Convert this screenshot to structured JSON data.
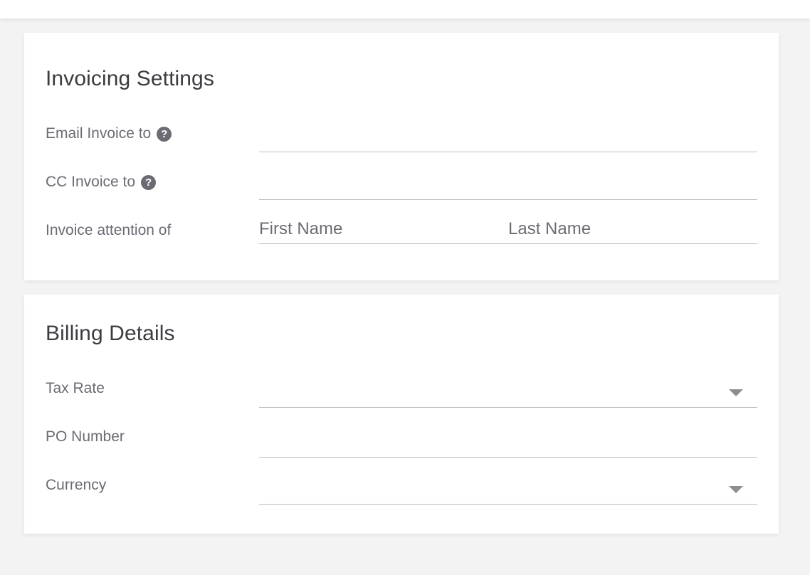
{
  "invoicing": {
    "title": "Invoicing Settings",
    "email_label": "Email Invoice to",
    "email_value": "",
    "cc_label": "CC Invoice to",
    "cc_value": "",
    "attention_label": "Invoice attention of",
    "first_name_placeholder": "First Name",
    "last_name_placeholder": "Last Name"
  },
  "billing": {
    "title": "Billing Details",
    "tax_rate_label": "Tax Rate",
    "tax_rate_value": "",
    "po_number_label": "PO Number",
    "po_number_value": "",
    "currency_label": "Currency",
    "currency_value": ""
  },
  "icons": {
    "help": "question-circle-icon",
    "dropdown": "caret-down-icon"
  },
  "help_glyph": "?",
  "colors": {
    "background": "#f3f3f3",
    "card": "#ffffff",
    "label": "#6b6b74",
    "title": "#3c3c41",
    "underline": "#b9bec4",
    "caret": "#8d8d93"
  }
}
